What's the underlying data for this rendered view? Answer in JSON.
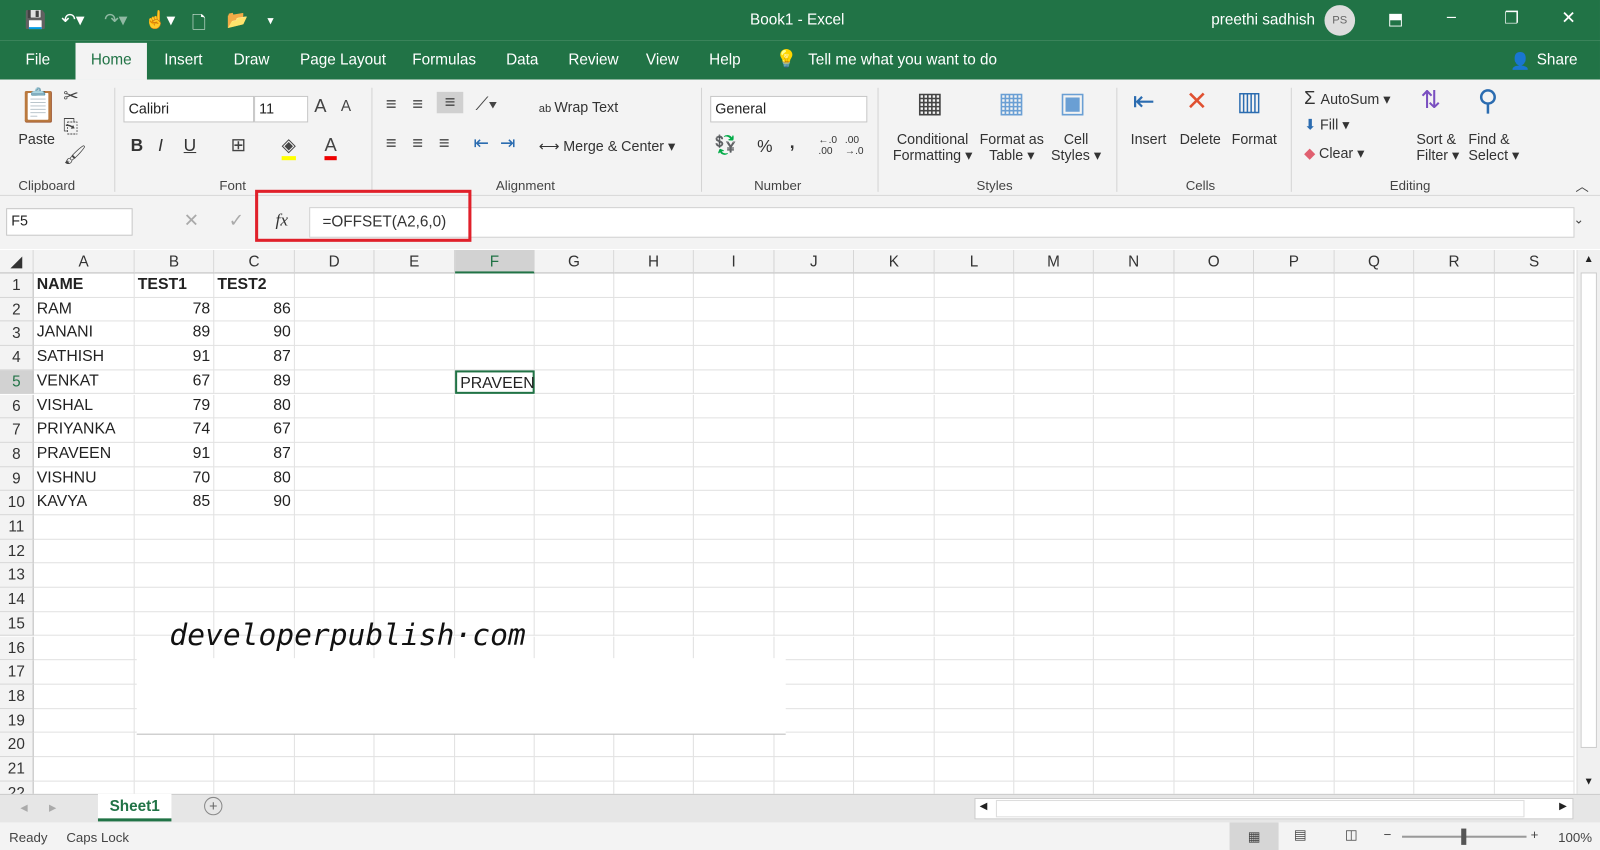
{
  "title": {
    "doc": "Book1  -  Excel",
    "user": "preethi sadhish",
    "initials": "PS",
    "minimize": "–",
    "restore": "❐",
    "close": "✕"
  },
  "tabs": [
    "File",
    "Home",
    "Insert",
    "Draw",
    "Page Layout",
    "Formulas",
    "Data",
    "Review",
    "View",
    "Help"
  ],
  "tell_me": "Tell me what you want to do",
  "share": "Share",
  "ribbon": {
    "clipboard": {
      "label": "Clipboard",
      "paste": "Paste"
    },
    "font": {
      "label": "Font",
      "name": "Calibri",
      "size": "11",
      "bold": "B",
      "italic": "I",
      "underline": "U"
    },
    "alignment": {
      "label": "Alignment",
      "wrap": "Wrap Text",
      "merge": "Merge & Center"
    },
    "number": {
      "label": "Number",
      "format": "General",
      "percent": "%",
      "comma": ","
    },
    "styles": {
      "label": "Styles",
      "cond1": "Conditional",
      "cond2": "Formatting",
      "fmt1": "Format as",
      "fmt2": "Table",
      "cell1": "Cell",
      "cell2": "Styles"
    },
    "cells": {
      "label": "Cells",
      "insert": "Insert",
      "delete": "Delete",
      "format": "Format"
    },
    "editing": {
      "label": "Editing",
      "autosum": "AutoSum",
      "fill": "Fill",
      "clear": "Clear",
      "sort1": "Sort &",
      "sort2": "Filter",
      "find1": "Find &",
      "find2": "Select"
    }
  },
  "formula_bar": {
    "name_box": "F5",
    "fx": "fx",
    "formula": "=OFFSET(A2,6,0)"
  },
  "columns": [
    "A",
    "B",
    "C",
    "D",
    "E",
    "F",
    "G",
    "H",
    "I",
    "J",
    "K",
    "L",
    "M",
    "N",
    "O",
    "P",
    "Q",
    "R",
    "S"
  ],
  "rows": [
    [
      "NAME",
      "TEST1",
      "TEST2"
    ],
    [
      "RAM",
      "78",
      "86"
    ],
    [
      "JANANI",
      "89",
      "90"
    ],
    [
      "SATHISH",
      "91",
      "87"
    ],
    [
      "VENKAT",
      "67",
      "89"
    ],
    [
      "VISHAL",
      "79",
      "80"
    ],
    [
      "PRIYANKA",
      "74",
      "67"
    ],
    [
      "PRAVEEN",
      "91",
      "87"
    ],
    [
      "VISHNU",
      "70",
      "80"
    ],
    [
      "KAVYA",
      "85",
      "90"
    ]
  ],
  "active_cell_value": "PRAVEEN",
  "watermark": "developerpublish·com",
  "sheet_tab": "Sheet1",
  "status": {
    "ready": "Ready",
    "caps": "Caps Lock",
    "zoom": "100%"
  }
}
